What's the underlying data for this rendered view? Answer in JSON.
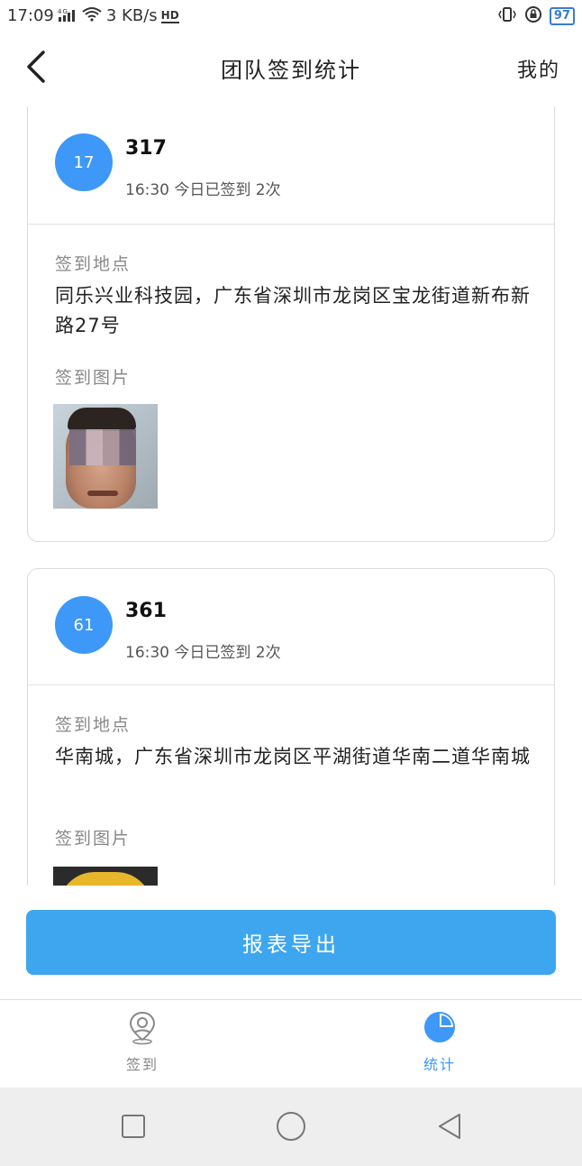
{
  "status_bar": {
    "time": "17:09",
    "network": "4G",
    "speed": "3 KB/s",
    "hd": "HD",
    "battery": "97"
  },
  "header": {
    "title": "团队签到统计",
    "right_label": "我的"
  },
  "cards": [
    {
      "avatar_text": "17",
      "name": "317",
      "meta": "16:30 今日已签到 2次",
      "location_label": "签到地点",
      "address": "同乐兴业科技园，广东省深圳市龙岗区宝龙街道新布新路27号",
      "photo_label": "签到图片"
    },
    {
      "avatar_text": "61",
      "name": "361",
      "meta": "16:30 今日已签到 2次",
      "location_label": "签到地点",
      "address": "华南城，广东省深圳市龙岗区平湖街道华南二道华南城",
      "photo_label": "签到图片"
    }
  ],
  "export_button": "报表导出",
  "tabs": [
    {
      "label": "签到",
      "icon": "location-pin-icon",
      "active": false
    },
    {
      "label": "统计",
      "icon": "pie-chart-icon",
      "active": true
    }
  ],
  "colors": {
    "accent": "#3d98f7",
    "button": "#3ea6ee",
    "inactive": "#888888"
  }
}
